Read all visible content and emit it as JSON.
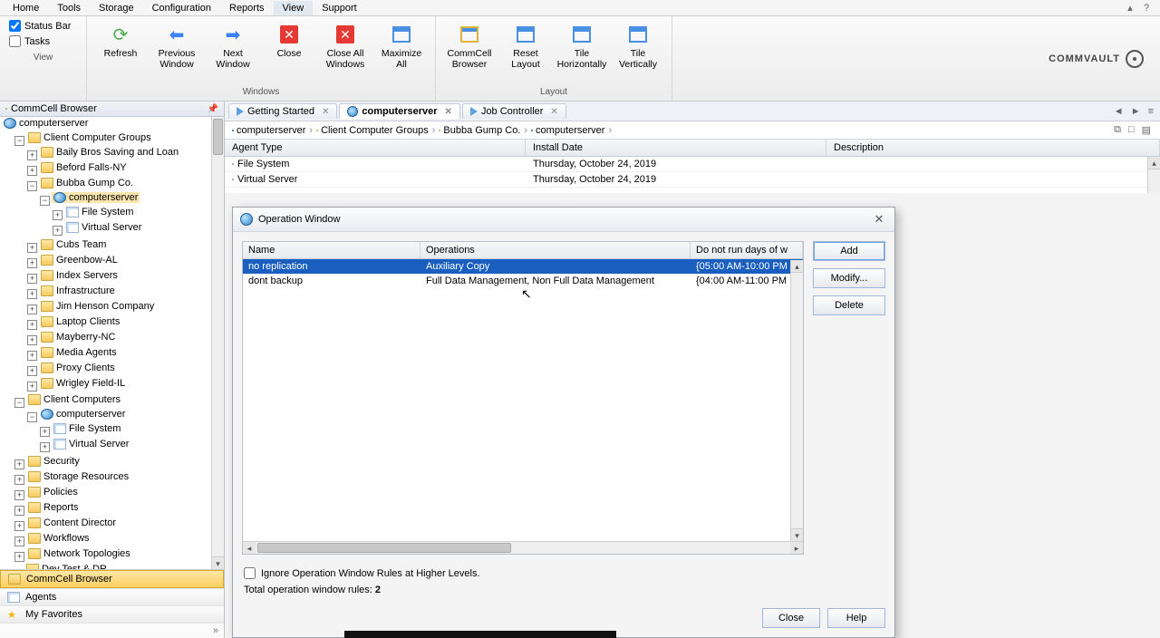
{
  "menubar": {
    "items": [
      "Home",
      "Tools",
      "Storage",
      "Configuration",
      "Reports",
      "View",
      "Support"
    ],
    "active_index": 5
  },
  "ribbon": {
    "checks": {
      "status_bar": "Status Bar",
      "tasks": "Tasks"
    },
    "buttons": {
      "refresh": "Refresh",
      "prev": "Previous Window",
      "next": "Next Window",
      "close": "Close",
      "close_all": "Close All Windows",
      "maximize": "Maximize All",
      "commcell": "CommCell Browser",
      "reset": "Reset Layout",
      "tile_h": "Tile Horizontally",
      "tile_v": "Tile Vertically"
    },
    "groups": {
      "view": "View",
      "windows": "Windows",
      "layout": "Layout"
    },
    "brand": "COMMVAULT"
  },
  "left": {
    "title": "CommCell Browser",
    "root": "computerserver",
    "groups_label": "Client Computer Groups",
    "groups": [
      "Baily Bros Saving and Loan",
      "Beford Falls-NY"
    ],
    "bubba": {
      "label": "Bubba Gump Co.",
      "server": "computerserver",
      "children": [
        "File System",
        "Virtual Server"
      ]
    },
    "groups2": [
      "Cubs Team",
      "Greenbow-AL",
      "Index Servers",
      "Infrastructure",
      "Jim Henson Company",
      "Laptop Clients",
      "Mayberry-NC",
      "Media Agents",
      "Proxy Clients",
      "Wrigley Field-IL"
    ],
    "clients_label": "Client Computers",
    "client_server": "computerserver",
    "client_children": [
      "File System",
      "Virtual Server"
    ],
    "rest": [
      "Security",
      "Storage Resources",
      "Policies",
      "Reports",
      "Content Director",
      "Workflows",
      "Network Topologies",
      "Dev Test & DR"
    ],
    "tabs": {
      "browser": "CommCell Browser",
      "agents": "Agents",
      "favorites": "My Favorites"
    }
  },
  "tabs": {
    "items": [
      {
        "label": "Getting Started"
      },
      {
        "label": "computerserver"
      },
      {
        "label": "Job Controller"
      }
    ],
    "active_index": 1,
    "nav": {
      "prev": "◄",
      "next": "►",
      "list": "≡"
    }
  },
  "breadcrumb": {
    "parts": [
      "computerserver",
      "Client Computer Groups",
      "Bubba Gump Co.",
      "computerserver"
    ]
  },
  "grid": {
    "cols": {
      "agent": "Agent Type",
      "install": "Install Date",
      "desc": "Description"
    },
    "rows": [
      {
        "agent": "File System",
        "install": "Thursday, October 24, 2019"
      },
      {
        "agent": "Virtual Server",
        "install": "Thursday, October 24, 2019"
      }
    ]
  },
  "dialog": {
    "title": "Operation Window",
    "cols": {
      "name": "Name",
      "ops": "Operations",
      "time": "Do not run days of w"
    },
    "rows": [
      {
        "name": "no replication",
        "ops": "Auxiliary Copy",
        "time": "{05:00 AM-10:00 PM"
      },
      {
        "name": "dont backup",
        "ops": "Full Data Management, Non Full Data Management",
        "time": "{04:00 AM-11:00 PM"
      }
    ],
    "buttons": {
      "add": "Add",
      "modify": "Modify...",
      "delete": "Delete"
    },
    "ignore": "Ignore Operation Window Rules at Higher Levels.",
    "total_label": "Total operation window rules:  ",
    "total_value": "2",
    "close": "Close",
    "help": "Help"
  }
}
